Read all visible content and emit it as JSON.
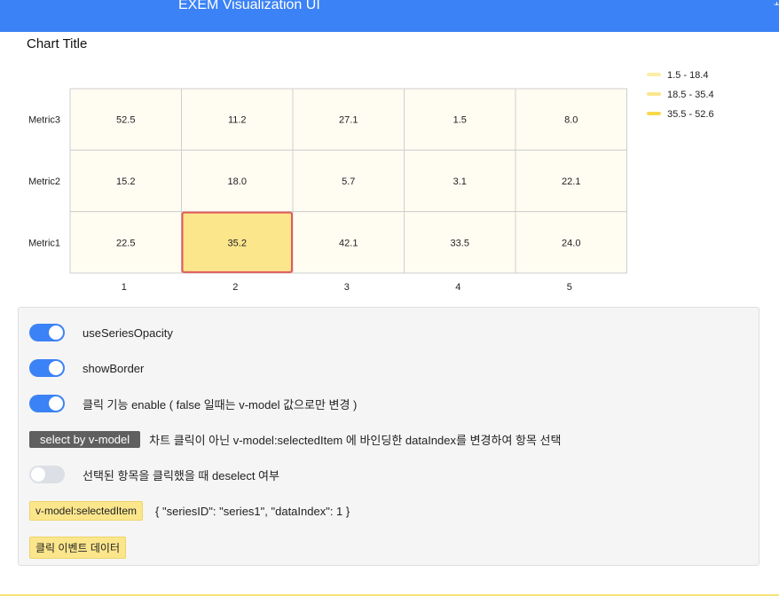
{
  "header": {
    "title": "EXEM Visualization UI",
    "corner_glyph": "+"
  },
  "chart_data": {
    "type": "heatmap",
    "title": "Chart Title",
    "x_categories": [
      "1",
      "2",
      "3",
      "4",
      "5"
    ],
    "y_categories": [
      "Metric1",
      "Metric2",
      "Metric3"
    ],
    "values": [
      {
        "metric": "Metric3",
        "row": [
          52.5,
          11.2,
          27.1,
          1.5,
          8.0
        ]
      },
      {
        "metric": "Metric2",
        "row": [
          15.2,
          18.0,
          5.7,
          3.1,
          22.1
        ]
      },
      {
        "metric": "Metric1",
        "row": [
          22.5,
          35.2,
          42.1,
          33.5,
          24.0
        ]
      }
    ],
    "selected": {
      "metric": "Metric1",
      "x": "2"
    },
    "legend": {
      "position": "top-right",
      "items": [
        {
          "label": "1.5 - 18.4",
          "color": "#fdeea5"
        },
        {
          "label": "18.5 - 35.4",
          "color": "#fce68c"
        },
        {
          "label": "35.5 - 52.6",
          "color": "#f8d94e"
        }
      ]
    },
    "colors": {
      "cell_fill": "#fffcf2",
      "selected_fill": "#fce68c",
      "selected_border": "#e05a5a",
      "grid": "#cfcfcf"
    }
  },
  "controls": {
    "toggle_opacity_label": "useSeriesOpacity",
    "toggle_border_label": "showBorder",
    "toggle_click_label": "클릭 기능 enable ( false 일때는 v-model 값으로만 변경 )",
    "select_button_label": "select by v-model",
    "select_desc": "차트 클릭이 아닌 v-model:selectedItem 에 바인딩한 dataIndex를 변경하여 항목 선택",
    "toggle_deselect_label": "선택된 항목을 클릭했을 때 deselect 여부",
    "vmodel_tag": "v-model:selectedItem",
    "vmodel_value": "{ \"seriesID\": \"series1\", \"dataIndex\": 1 }",
    "click_event_tag": "클릭 이벤트 데이터",
    "toggles": {
      "opacity": true,
      "border": true,
      "click": true,
      "deselect": false
    }
  },
  "theme": {
    "primary": "#3b82f6",
    "panel_bg": "#f5f5f5",
    "tag_yellow": "#fce68c"
  }
}
